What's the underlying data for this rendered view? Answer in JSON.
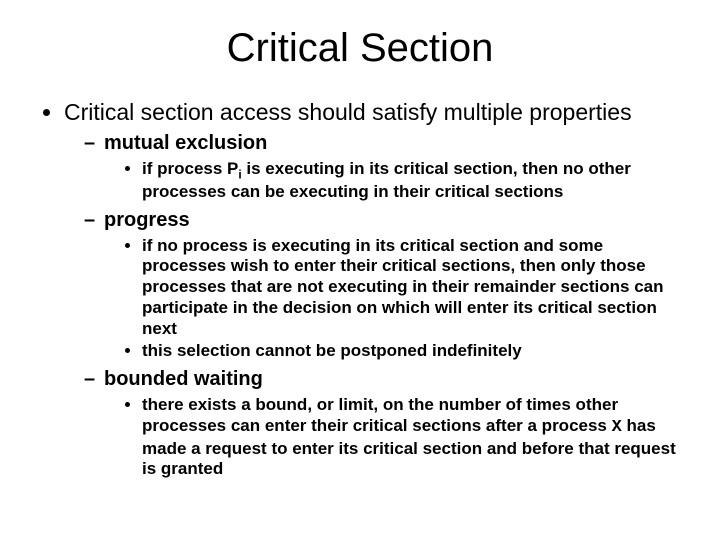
{
  "title": "Critical Section",
  "bullets": {
    "top": "Critical section access should satisfy multiple properties",
    "props": [
      {
        "name": "mutual exclusion",
        "items": [
          "if process Pₗ is executing in its critical section, then no other processes can be executing in their critical sections"
        ]
      },
      {
        "name": "progress",
        "items": [
          "if no process is executing in its critical section and some processes wish to enter their critical sections, then only those processes that are not executing in their remainder sections can participate in the decision on which will enter its critical section next",
          "this selection cannot be postponed indefinitely"
        ]
      },
      {
        "name": "bounded waiting",
        "items": [
          "there exists a bound, or limit, on the number of times other processes can enter their critical sections after a process X has made a request to enter its critical section and before that request is granted"
        ]
      }
    ]
  }
}
